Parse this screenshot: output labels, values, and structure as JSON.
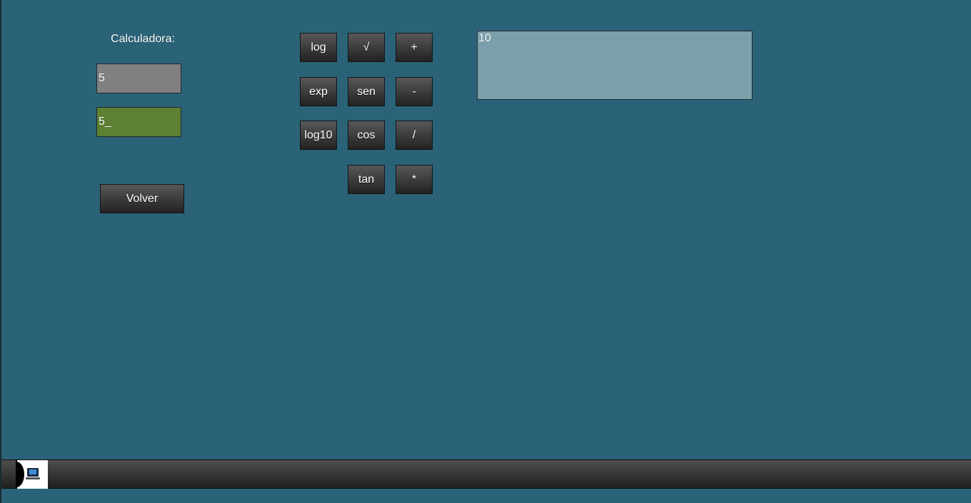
{
  "calculator": {
    "title": "Calculadora:",
    "field_a_value": "5",
    "field_b_value": "5_",
    "back_label": "Volver",
    "result_value": "10"
  },
  "buttons": {
    "log": "log",
    "sqrt": "√",
    "add": "+",
    "exp": "exp",
    "sin": "sen",
    "subtract": "-",
    "log10": "log10",
    "cos": "cos",
    "divide": "/",
    "tan": "tan",
    "multiply": "*"
  },
  "taskbar": {
    "start_icon": "computer-icon"
  },
  "colors": {
    "background": "#2a6377",
    "field_a": "#808080",
    "field_b": "#5d8032",
    "display": "#7ba0ac"
  }
}
